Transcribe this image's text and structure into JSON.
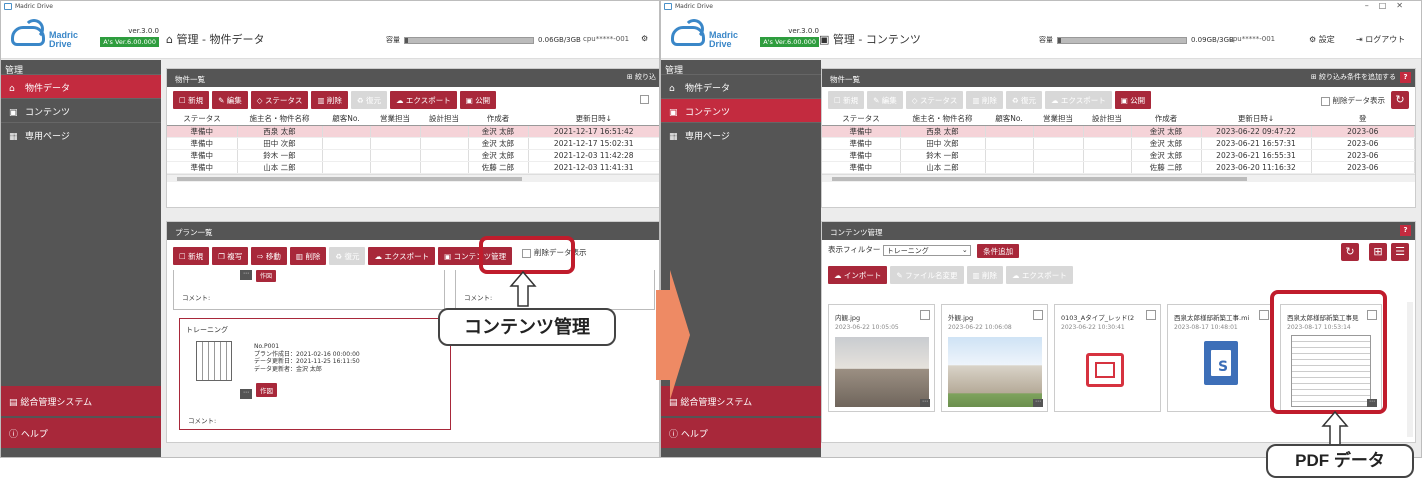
{
  "app_name": "Madric Drive",
  "logo": {
    "line1": "Madric",
    "line2": "Drive",
    "version": "ver.3.0.0",
    "as_version": "A's Ver.6.00.000"
  },
  "sidebar": {
    "heading": "管理",
    "items": [
      {
        "label": "物件データ",
        "icon": "house-icon"
      },
      {
        "label": "コンテンツ",
        "icon": "image-icon"
      },
      {
        "label": "専用ページ",
        "icon": "page-icon"
      }
    ],
    "system": "総合管理システム",
    "help": "ヘルプ"
  },
  "left": {
    "title": "管理 - 物件データ",
    "capacity_label": "容量",
    "capacity_text": "0.06GB/3GB",
    "cpu": "cpu*****-001",
    "list_panel": {
      "title": "物件一覧",
      "filter_label": "絞り込",
      "buttons": [
        "新規",
        "編集",
        "ステータス",
        "削除",
        "復元",
        "エクスポート",
        "公開"
      ]
    },
    "plan_panel": {
      "title": "プラン一覧",
      "buttons": [
        "新規",
        "複写",
        "移動",
        "削除",
        "復元",
        "エクスポート",
        "コンテンツ管理"
      ],
      "deleted_label": "削除データ表示",
      "comment_label": "コメント:",
      "sakuzu": "作図",
      "card_name": "トレーニング",
      "card_info": [
        "No.P001",
        "プラン作成日：2021-02-16 00:00:00",
        "データ更新日：2021-11-25 16:11:50",
        "データ更新者：金沢 太郎"
      ]
    }
  },
  "right": {
    "title": "管理 - コンテンツ",
    "capacity_label": "容量",
    "capacity_text": "0.09GB/3GB",
    "cpu": "cpu*****-001",
    "settings": "設定",
    "logout": "ログアウト",
    "list_panel": {
      "title": "物件一覧",
      "filter_label": "絞り込み条件を追加する",
      "buttons": [
        "新規",
        "編集",
        "ステータス",
        "削除",
        "復元",
        "エクスポート",
        "公開"
      ],
      "deleted_label": "削除データ表示"
    },
    "content_panel": {
      "title": "コンテンツ管理",
      "filter_label": "表示フィルター",
      "filter_value": "トレーニング",
      "add_condition": "条件追加",
      "buttons": [
        "インポート",
        "ファイル名変更",
        "削除",
        "エクスポート"
      ],
      "files": [
        {
          "name": "内観.jpg",
          "date": "2023-06-22 10:05:05"
        },
        {
          "name": "外観.jpg",
          "date": "2023-06-22 10:06:08"
        },
        {
          "name": "0103_Aタイプ_レッド(2",
          "date": "2023-06-22 10:30:41"
        },
        {
          "name": "西泉太郎様邸新築工事.mi",
          "date": "2023-08-17 10:48:01"
        },
        {
          "name": "西泉太郎様邸新築工事見",
          "date": "2023-08-17 10:53:14"
        }
      ]
    }
  },
  "table": {
    "headers": [
      "ステータス",
      "施主名・物件名称",
      "顧客No.",
      "営業担当",
      "設計担当",
      "作成者",
      "更新日時↓"
    ],
    "left_rows": [
      [
        "準備中",
        "西泉 太郎",
        "",
        "",
        "",
        "金沢 太郎",
        "2021-12-17 16:51:42"
      ],
      [
        "準備中",
        "田中 次郎",
        "",
        "",
        "",
        "金沢 太郎",
        "2021-12-17 15:02:31"
      ],
      [
        "準備中",
        "鈴木 一郎",
        "",
        "",
        "",
        "金沢 太郎",
        "2021-12-03 11:42:28"
      ],
      [
        "準備中",
        "山本 二郎",
        "",
        "",
        "",
        "佐藤 二郎",
        "2021-12-03 11:41:31"
      ]
    ],
    "right_rows": [
      [
        "準備中",
        "西泉 太郎",
        "",
        "",
        "",
        "金沢 太郎",
        "2023-06-22 09:47:22",
        "2023-06"
      ],
      [
        "準備中",
        "田中 次郎",
        "",
        "",
        "",
        "金沢 太郎",
        "2023-06-21 16:57:31",
        "2023-06"
      ],
      [
        "準備中",
        "鈴木 一郎",
        "",
        "",
        "",
        "金沢 太郎",
        "2023-06-21 16:55:31",
        "2023-06"
      ],
      [
        "準備中",
        "山本 二郎",
        "",
        "",
        "",
        "佐藤 二郎",
        "2023-06-20 11:16:32",
        "2023-06"
      ]
    ],
    "right_extra_header": "登"
  },
  "callouts": {
    "contents_manage": "コンテンツ管理",
    "pdf_data": "PDF データ"
  },
  "colors": {
    "accent": "#a8283a",
    "sidebar": "#555555",
    "active": "#c32b3f",
    "highlight": "#c01c2c",
    "arrow": "#ee8a64"
  }
}
